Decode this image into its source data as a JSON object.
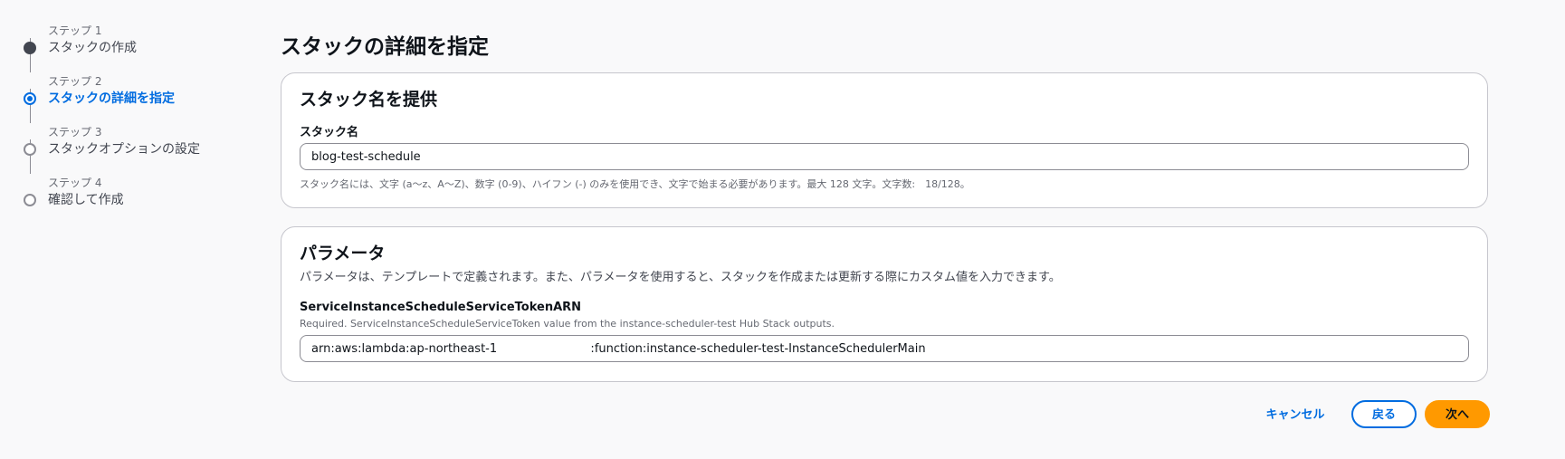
{
  "steps": [
    {
      "number": "ステップ 1",
      "label": "スタックの作成",
      "state": "done"
    },
    {
      "number": "ステップ 2",
      "label": "スタックの詳細を指定",
      "state": "active"
    },
    {
      "number": "ステップ 3",
      "label": "スタックオプションの設定",
      "state": "pending"
    },
    {
      "number": "ステップ 4",
      "label": "確認して作成",
      "state": "pending"
    }
  ],
  "page": {
    "title": "スタックの詳細を指定"
  },
  "stack_name_section": {
    "title": "スタック名を提供",
    "field_label": "スタック名",
    "value": "blog-test-schedule",
    "hint": "スタック名には、文字 (a〜z、A〜Z)、数字 (0-9)、ハイフン (-) のみを使用でき、文字で始まる必要があります。最大 128 文字。文字数:　18/128。"
  },
  "parameters_section": {
    "title": "パラメータ",
    "description": "パラメータは、テンプレートで定義されます。また、パラメータを使用すると、スタックを作成または更新する際にカスタム値を入力できます。",
    "params": [
      {
        "name": "ServiceInstanceScheduleServiceTokenARN",
        "help": "Required. ServiceInstanceScheduleServiceToken value from the instance-scheduler-test Hub Stack outputs.",
        "value": "arn:aws:lambda:ap-northeast-1                         :function:instance-scheduler-test-InstanceSchedulerMain"
      }
    ]
  },
  "actions": {
    "cancel_label": "キャンセル",
    "back_label": "戻る",
    "next_label": "次へ"
  },
  "colors": {
    "accent": "#006ce0",
    "primary_button": "#ff9900",
    "completed_step": "#424650"
  }
}
